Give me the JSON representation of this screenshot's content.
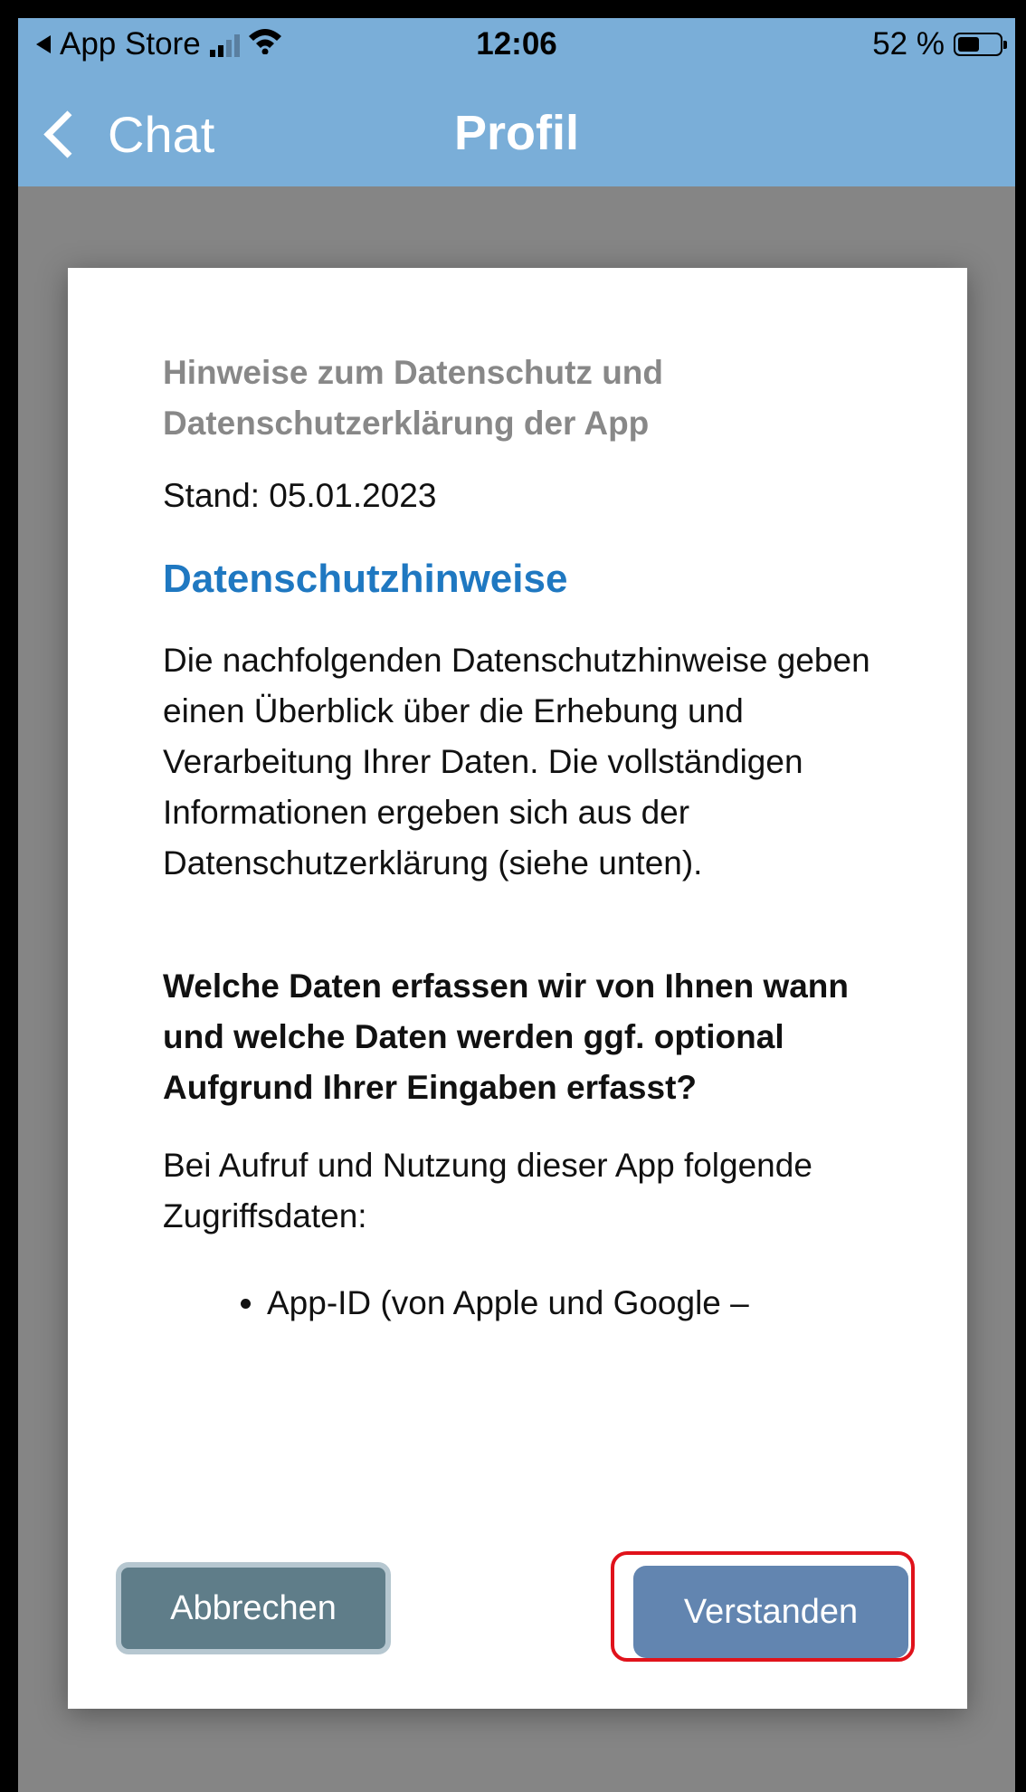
{
  "status_bar": {
    "back_app": "App Store",
    "time": "12:06",
    "battery": "52 %",
    "battery_level": 0.52,
    "signal_bars": 2,
    "signal_total": 4
  },
  "nav": {
    "back_label": "Chat",
    "title": "Profil"
  },
  "modal": {
    "title": "Hinweise zum Datenschutz und Datenschutzerklärung der App",
    "date": "Stand: 05.01.2023",
    "section_heading": "Datenschutzhinweise",
    "intro": "Die nachfolgenden Datenschutzhinweise geben einen Überblick über die Erhebung und Verarbeitung Ihrer Daten. Die vollständigen Informationen ergeben sich aus der Datenschutzerklärung (siehe unten).",
    "question": "Welche Daten erfassen wir von Ihnen wann und welche Daten werden ggf. optional Aufgrund Ihrer Eingaben erfasst?",
    "usage_text": "Bei Aufruf und Nutzung dieser App folgende Zugriffsdaten:",
    "list_items": [
      "App-ID (von Apple und Google –"
    ],
    "cancel_label": "Abbrechen",
    "confirm_label": "Verstanden"
  },
  "icons": {
    "wifi": "wifi-icon",
    "battery": "battery-icon",
    "signal": "cellular-signal-icon",
    "back": "chevron-left-icon"
  },
  "colors": {
    "header": "#7aaed8",
    "overlay": "#858585",
    "heading_blue": "#1f78c1",
    "cancel_button": "#5f7d89",
    "confirm_button": "#6285b0",
    "highlight": "#e0121b"
  }
}
